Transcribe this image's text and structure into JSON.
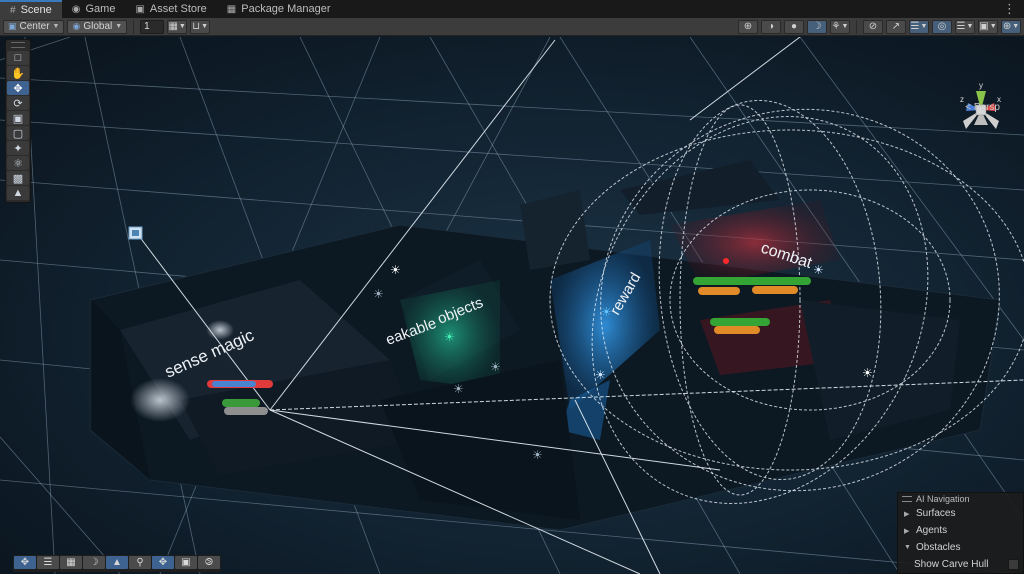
{
  "tabs": [
    {
      "label": "Scene",
      "icon": "grid-icon",
      "active": true
    },
    {
      "label": "Game",
      "icon": "gamepad-icon",
      "active": false
    },
    {
      "label": "Asset Store",
      "icon": "store-bag-icon",
      "active": false
    },
    {
      "label": "Package Manager",
      "icon": "package-icon",
      "active": false
    }
  ],
  "tab_menu_icon": "more-vertical-icon",
  "toolbar": {
    "pivot_label": "Center",
    "space_label": "Global",
    "snap_value": "1"
  },
  "scene_labels": {
    "sense_magic": "sense magic",
    "breakable": "eakable",
    "objects": "objects",
    "reward": "reward",
    "combat": "combat"
  },
  "view": {
    "projection_label": "< Persp",
    "gizmo_axes": {
      "y": "y",
      "x": "x",
      "z": "z"
    }
  },
  "ai_navigation": {
    "title": "AI Navigation",
    "sections": [
      {
        "label": "Surfaces",
        "expanded": false
      },
      {
        "label": "Agents",
        "expanded": false
      },
      {
        "label": "Obstacles",
        "expanded": true
      }
    ],
    "show_carve_hull_label": "Show Carve Hull",
    "show_carve_hull_checked": false
  },
  "colors": {
    "active_tab_accent": "#3a79bb",
    "tool_active": "#3f6390",
    "combat_room": "#8a1d27",
    "reward_room": "#1f7fd6",
    "breakable_room": "#1aa37c",
    "grid_line": "#9fb8cc"
  }
}
